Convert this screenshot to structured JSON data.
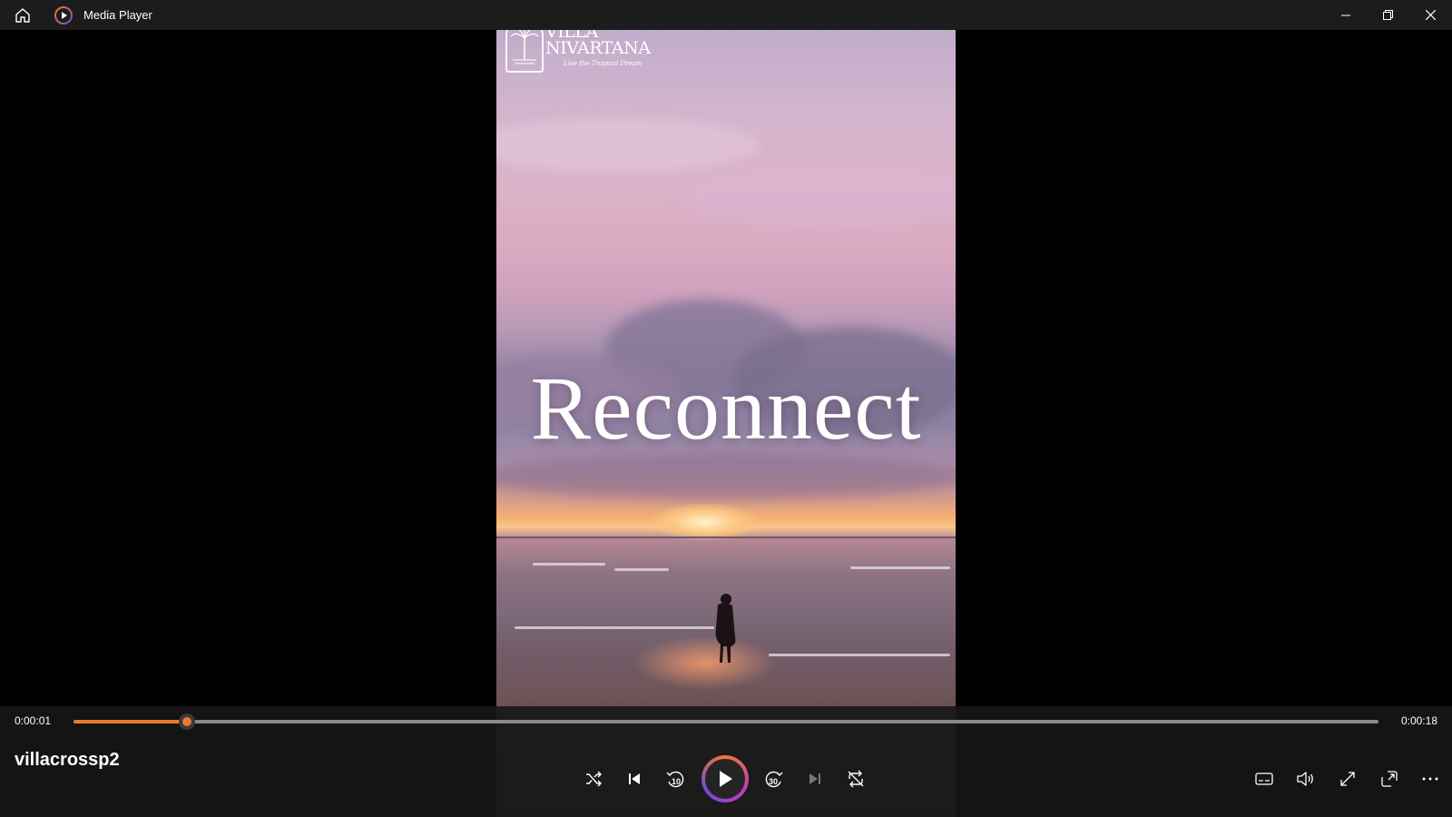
{
  "app": {
    "title": "Media Player"
  },
  "video": {
    "logo_line1": "VILLA",
    "logo_line2": "NIVARTANA",
    "logo_tagline": "Live the Tropical Dream",
    "headline": "Reconnect"
  },
  "player": {
    "current_time": "0:00:01",
    "total_time": "0:00:18",
    "progress_fraction": 0.087,
    "media_title": "villacrossp2",
    "skip_back_seconds": "10",
    "skip_forward_seconds": "30",
    "accent_color": "#ec7a2b"
  },
  "icons": {
    "home": "home-icon",
    "app": "media-player-icon",
    "minimize": "minimize-icon",
    "restore": "restore-icon",
    "close": "close-icon",
    "shuffle": "shuffle-icon",
    "previous": "previous-icon",
    "skip_back": "skip-back-10-icon",
    "play": "play-icon",
    "skip_forward": "skip-forward-30-icon",
    "next": "next-icon",
    "repeat": "repeat-off-icon",
    "captions": "captions-icon",
    "volume": "volume-icon",
    "fullscreen": "fullscreen-icon",
    "miniplayer": "miniplayer-icon",
    "more": "more-icon"
  }
}
